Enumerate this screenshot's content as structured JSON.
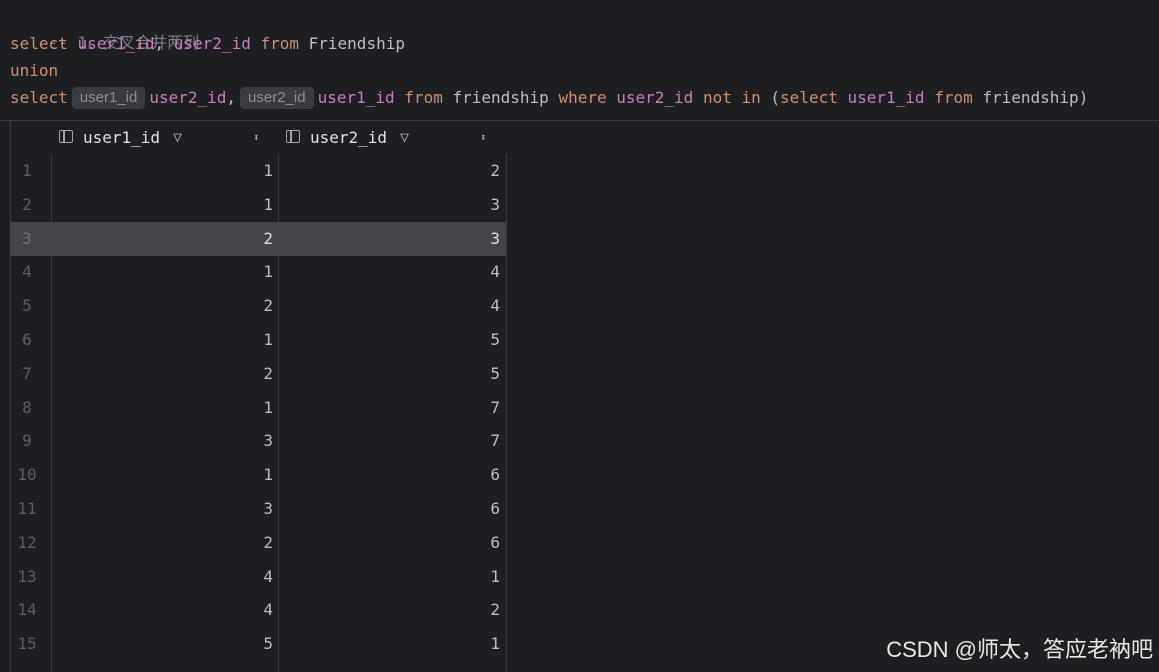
{
  "editor": {
    "comment": "-- 1、交叉合并两列",
    "line2": {
      "kw_select": "select",
      "col_a": "user1_id",
      "comma": ", ",
      "col_b": "user2_id",
      "kw_from": "from",
      "table": "Friendship"
    },
    "line3": {
      "kw_union": "union"
    },
    "line4": {
      "kw_select": "select",
      "hint_a": "user1_id",
      "col_a": "user2_id",
      "comma": ",",
      "hint_b": "user2_id",
      "col_b": "user1_id",
      "kw_from": "from",
      "table": "friendship",
      "kw_where": "where",
      "col_c": "user2_id",
      "kw_not": "not",
      "kw_in": "in",
      "paren_open": "(",
      "kw_select2": "select",
      "col_d": "user1_id",
      "kw_from2": "from",
      "table2": "friendship",
      "paren_close": ")"
    }
  },
  "grid": {
    "columns": [
      {
        "label": "user1_id",
        "icon": "column-icon",
        "filter_icon": "filter-icon",
        "sort_icon": "sort-icon"
      },
      {
        "label": "user2_id",
        "icon": "column-icon",
        "filter_icon": "filter-icon",
        "sort_icon": "sort-icon"
      }
    ],
    "selected_row": 3,
    "rows": [
      {
        "n": "1",
        "a": "1",
        "b": "2"
      },
      {
        "n": "2",
        "a": "1",
        "b": "3"
      },
      {
        "n": "3",
        "a": "2",
        "b": "3"
      },
      {
        "n": "4",
        "a": "1",
        "b": "4"
      },
      {
        "n": "5",
        "a": "2",
        "b": "4"
      },
      {
        "n": "6",
        "a": "1",
        "b": "5"
      },
      {
        "n": "7",
        "a": "2",
        "b": "5"
      },
      {
        "n": "8",
        "a": "1",
        "b": "7"
      },
      {
        "n": "9",
        "a": "3",
        "b": "7"
      },
      {
        "n": "10",
        "a": "1",
        "b": "6"
      },
      {
        "n": "11",
        "a": "3",
        "b": "6"
      },
      {
        "n": "12",
        "a": "2",
        "b": "6"
      },
      {
        "n": "13",
        "a": "4",
        "b": "1"
      },
      {
        "n": "14",
        "a": "4",
        "b": "2"
      },
      {
        "n": "15",
        "a": "5",
        "b": "1"
      }
    ]
  },
  "watermark": "CSDN @师太，答应老衲吧"
}
